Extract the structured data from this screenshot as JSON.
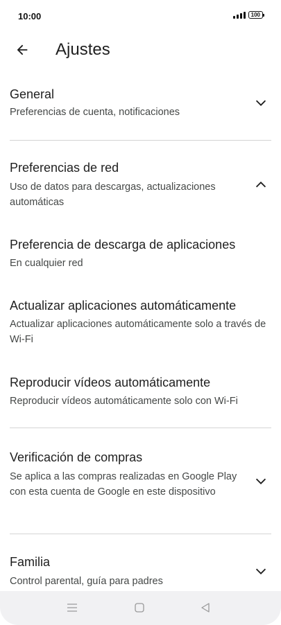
{
  "status_bar": {
    "time": "10:00",
    "battery": "100"
  },
  "header": {
    "title": "Ajustes",
    "back_icon": "arrow-back-icon"
  },
  "sections": {
    "general": {
      "title": "General",
      "subtitle": "Preferencias de cuenta, notificaciones",
      "state": "collapsed"
    },
    "network": {
      "title": "Preferencias de red",
      "subtitle": "Uso de datos para descargas, actualizaciones automáticas",
      "state": "expanded",
      "items": [
        {
          "title": "Preferencia de descarga de aplicaciones",
          "subtitle": "En cualquier red"
        },
        {
          "title": "Actualizar aplicaciones automáticamente",
          "subtitle": "Actualizar aplicaciones automáticamente solo a través de Wi-Fi"
        },
        {
          "title": "Reproducir vídeos automáticamente",
          "subtitle": "Reproducir vídeos automáticamente solo con Wi-Fi"
        }
      ]
    },
    "purchase": {
      "title": "Verificación de compras",
      "subtitle": "Se aplica a las compras realizadas en Google Play con esta cuenta de Google en este dispositivo",
      "state": "collapsed"
    },
    "family": {
      "title": "Familia",
      "subtitle": "Control parental, guía para padres",
      "state": "collapsed"
    }
  },
  "nav_bar": {
    "icons": [
      "menu-icon",
      "home-icon",
      "back-triangle-icon"
    ]
  },
  "colors": {
    "text_primary": "#1f1f1f",
    "text_secondary": "#444746",
    "divider": "#d4d4d4",
    "nav_bg": "#f1f1f3"
  }
}
